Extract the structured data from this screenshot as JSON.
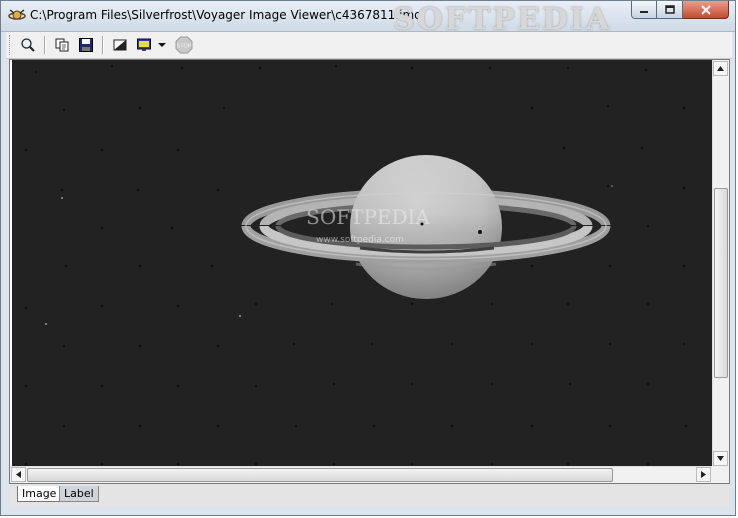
{
  "window": {
    "title": "C:\\Program Files\\Silverfrost\\Voyager Image Viewer\\c4367811.imq",
    "title_watermark": "SOFTPEDIA",
    "app_icon": "voyager-app-icon"
  },
  "caption_buttons": {
    "minimize": "minimize-icon",
    "maximize": "maximize-icon",
    "close": "close-icon"
  },
  "toolbar": {
    "buttons": [
      {
        "name": "zoom-icon"
      },
      {
        "name": "copy-icon"
      },
      {
        "name": "save-icon"
      },
      {
        "name": "contrast-icon"
      },
      {
        "name": "display-settings-icon"
      },
      {
        "name": "dropdown-arrow-icon"
      },
      {
        "name": "stop-icon",
        "label": "STOP",
        "disabled": true
      }
    ]
  },
  "image": {
    "subject": "Saturn",
    "watermark": "SOFTPEDIA",
    "watermark_url": "www.softpedia.com",
    "background_color": "#222222"
  },
  "tabs": [
    {
      "label": "Image",
      "active": true
    },
    {
      "label": "Label",
      "active": false
    }
  ]
}
